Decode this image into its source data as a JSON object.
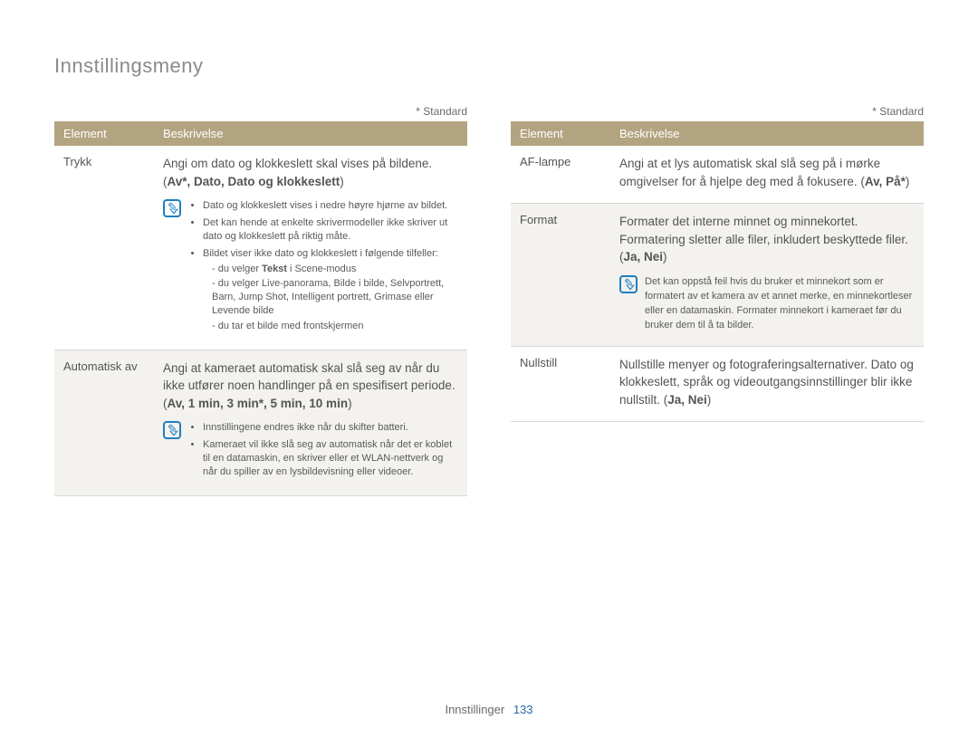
{
  "page_title": "Innstillingsmeny",
  "standard_note": "* Standard",
  "headers": {
    "element": "Element",
    "description": "Beskrivelse"
  },
  "footer": {
    "label": "Innstillinger",
    "page": "133"
  },
  "left": {
    "rows": [
      {
        "shaded": false,
        "element": "Trykk",
        "intro": "Angi om dato og klokkeslett skal vises på bildene. (",
        "opts": "Av*, Dato, Dato og klokkeslett",
        "close": ")",
        "note_bullets": [
          "Dato og klokkeslett vises i nedre høyre hjørne av bildet.",
          "Det kan hende at enkelte skrivermodeller ikke skriver ut dato og klokkeslett på riktig måte.",
          "Bildet viser ikke dato og klokkeslett i følgende tilfeller:"
        ],
        "note_dashes": [
          "du velger Tekst i Scene-modus",
          "du velger Live-panorama, Bilde i bilde, Selvportrett, Barn, Jump Shot, Intelligent portrett, Grimase eller Levende bilde",
          "du tar et bilde med frontskjermen"
        ],
        "note_inline_bold": "Tekst"
      },
      {
        "shaded": true,
        "element": "Automatisk av",
        "intro": "Angi at kameraet automatisk skal slå seg av når du ikke utfører noen handlinger på en spesifisert periode. (",
        "opts": "Av, 1 min, 3 min*, 5 min, 10 min",
        "close": ")",
        "note_bullets": [
          "Innstillingene endres ikke når du skifter batteri.",
          "Kameraet vil ikke slå seg av automatisk når det er koblet til en datamaskin, en skriver eller et WLAN-nettverk og når du spiller av en lysbildevisning eller videoer."
        ]
      }
    ]
  },
  "right": {
    "rows": [
      {
        "shaded": false,
        "element": "AF-lampe",
        "intro": "Angi at et lys automatisk skal slå seg på i mørke omgivelser for å hjelpe deg med å fokusere. (",
        "opts": "Av, På*",
        "close": ")"
      },
      {
        "shaded": true,
        "element": "Format",
        "intro": "Formater det interne minnet og minnekortet. Formatering sletter alle filer, inkludert beskyttede filer. (",
        "opts": "Ja, Nei",
        "close": ")",
        "note_text": "Det kan oppstå feil hvis du bruker et minnekort som er formatert av et kamera av et annet merke, en minnekortleser eller en datamaskin. Formater minnekort i kameraet før du bruker dem til å ta bilder."
      },
      {
        "shaded": false,
        "element": "Nullstill",
        "intro": "Nullstille menyer og fotograferingsalternativer. Dato og klokkeslett, språk og videoutgangsinnstillinger blir ikke nullstilt. (",
        "opts": "Ja, Nei",
        "close": ")"
      }
    ]
  }
}
